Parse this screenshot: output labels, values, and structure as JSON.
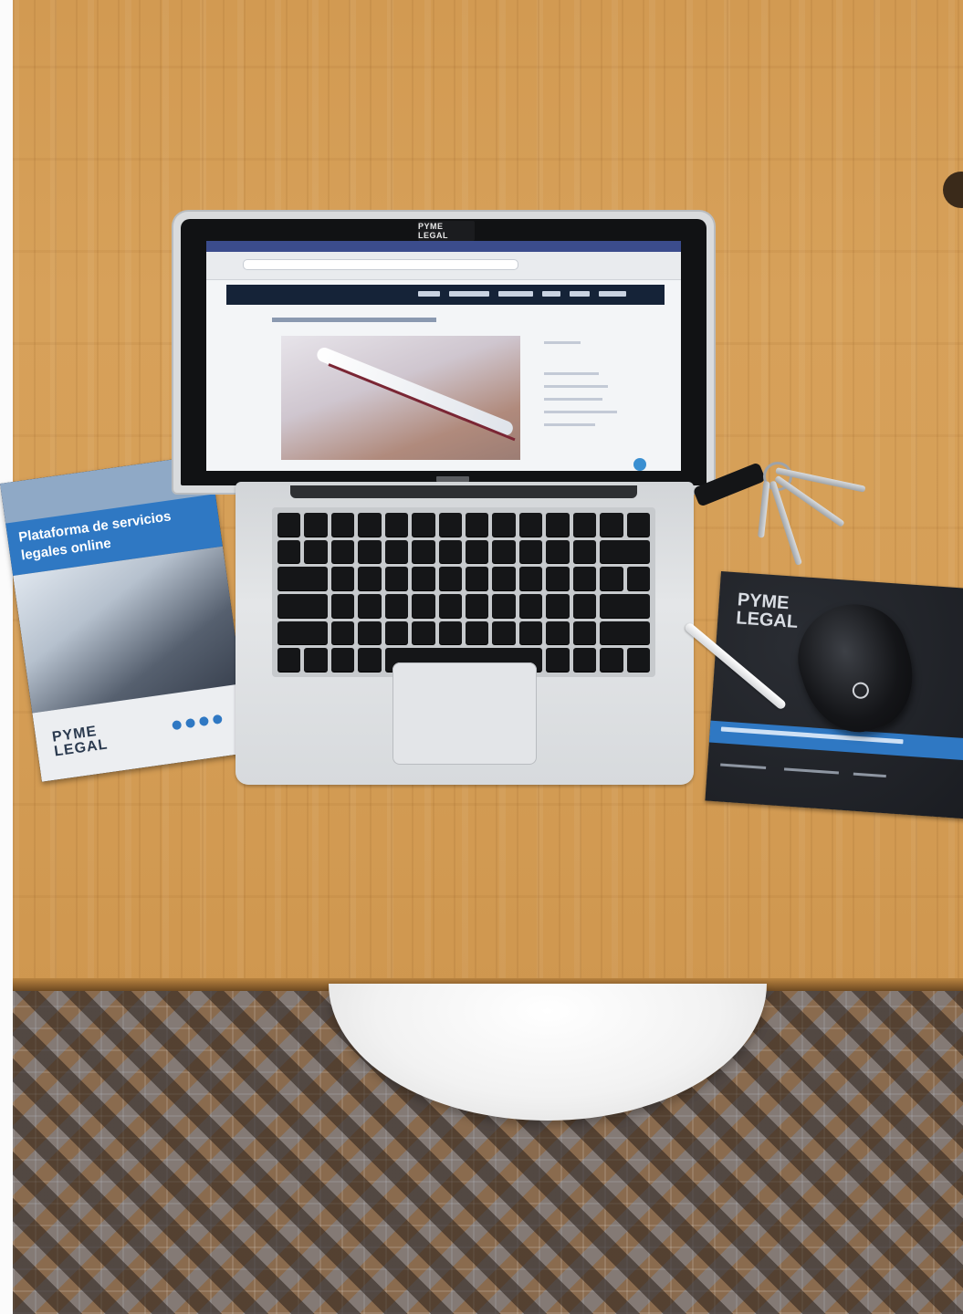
{
  "photo": {
    "brochure_title": "Plataforma de servicios legales online",
    "brochure_logo_top": "PYME",
    "brochure_logo_bottom": "LEGAL",
    "mousepad_logo_top": "PYME",
    "mousepad_logo_bottom": "LEGAL",
    "webcam_sticker": "PYME LEGAL"
  },
  "colors": {
    "wood": "#d29a52",
    "brand_blue": "#2f78c3",
    "navy": "#152338"
  }
}
